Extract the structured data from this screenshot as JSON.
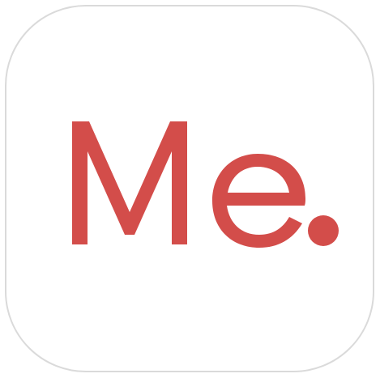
{
  "app_icon": {
    "logo_text": "Me",
    "logo_dot": ".",
    "colors": {
      "background": "#ffffff",
      "border": "#dadada",
      "logo": "#d34d4a"
    }
  }
}
